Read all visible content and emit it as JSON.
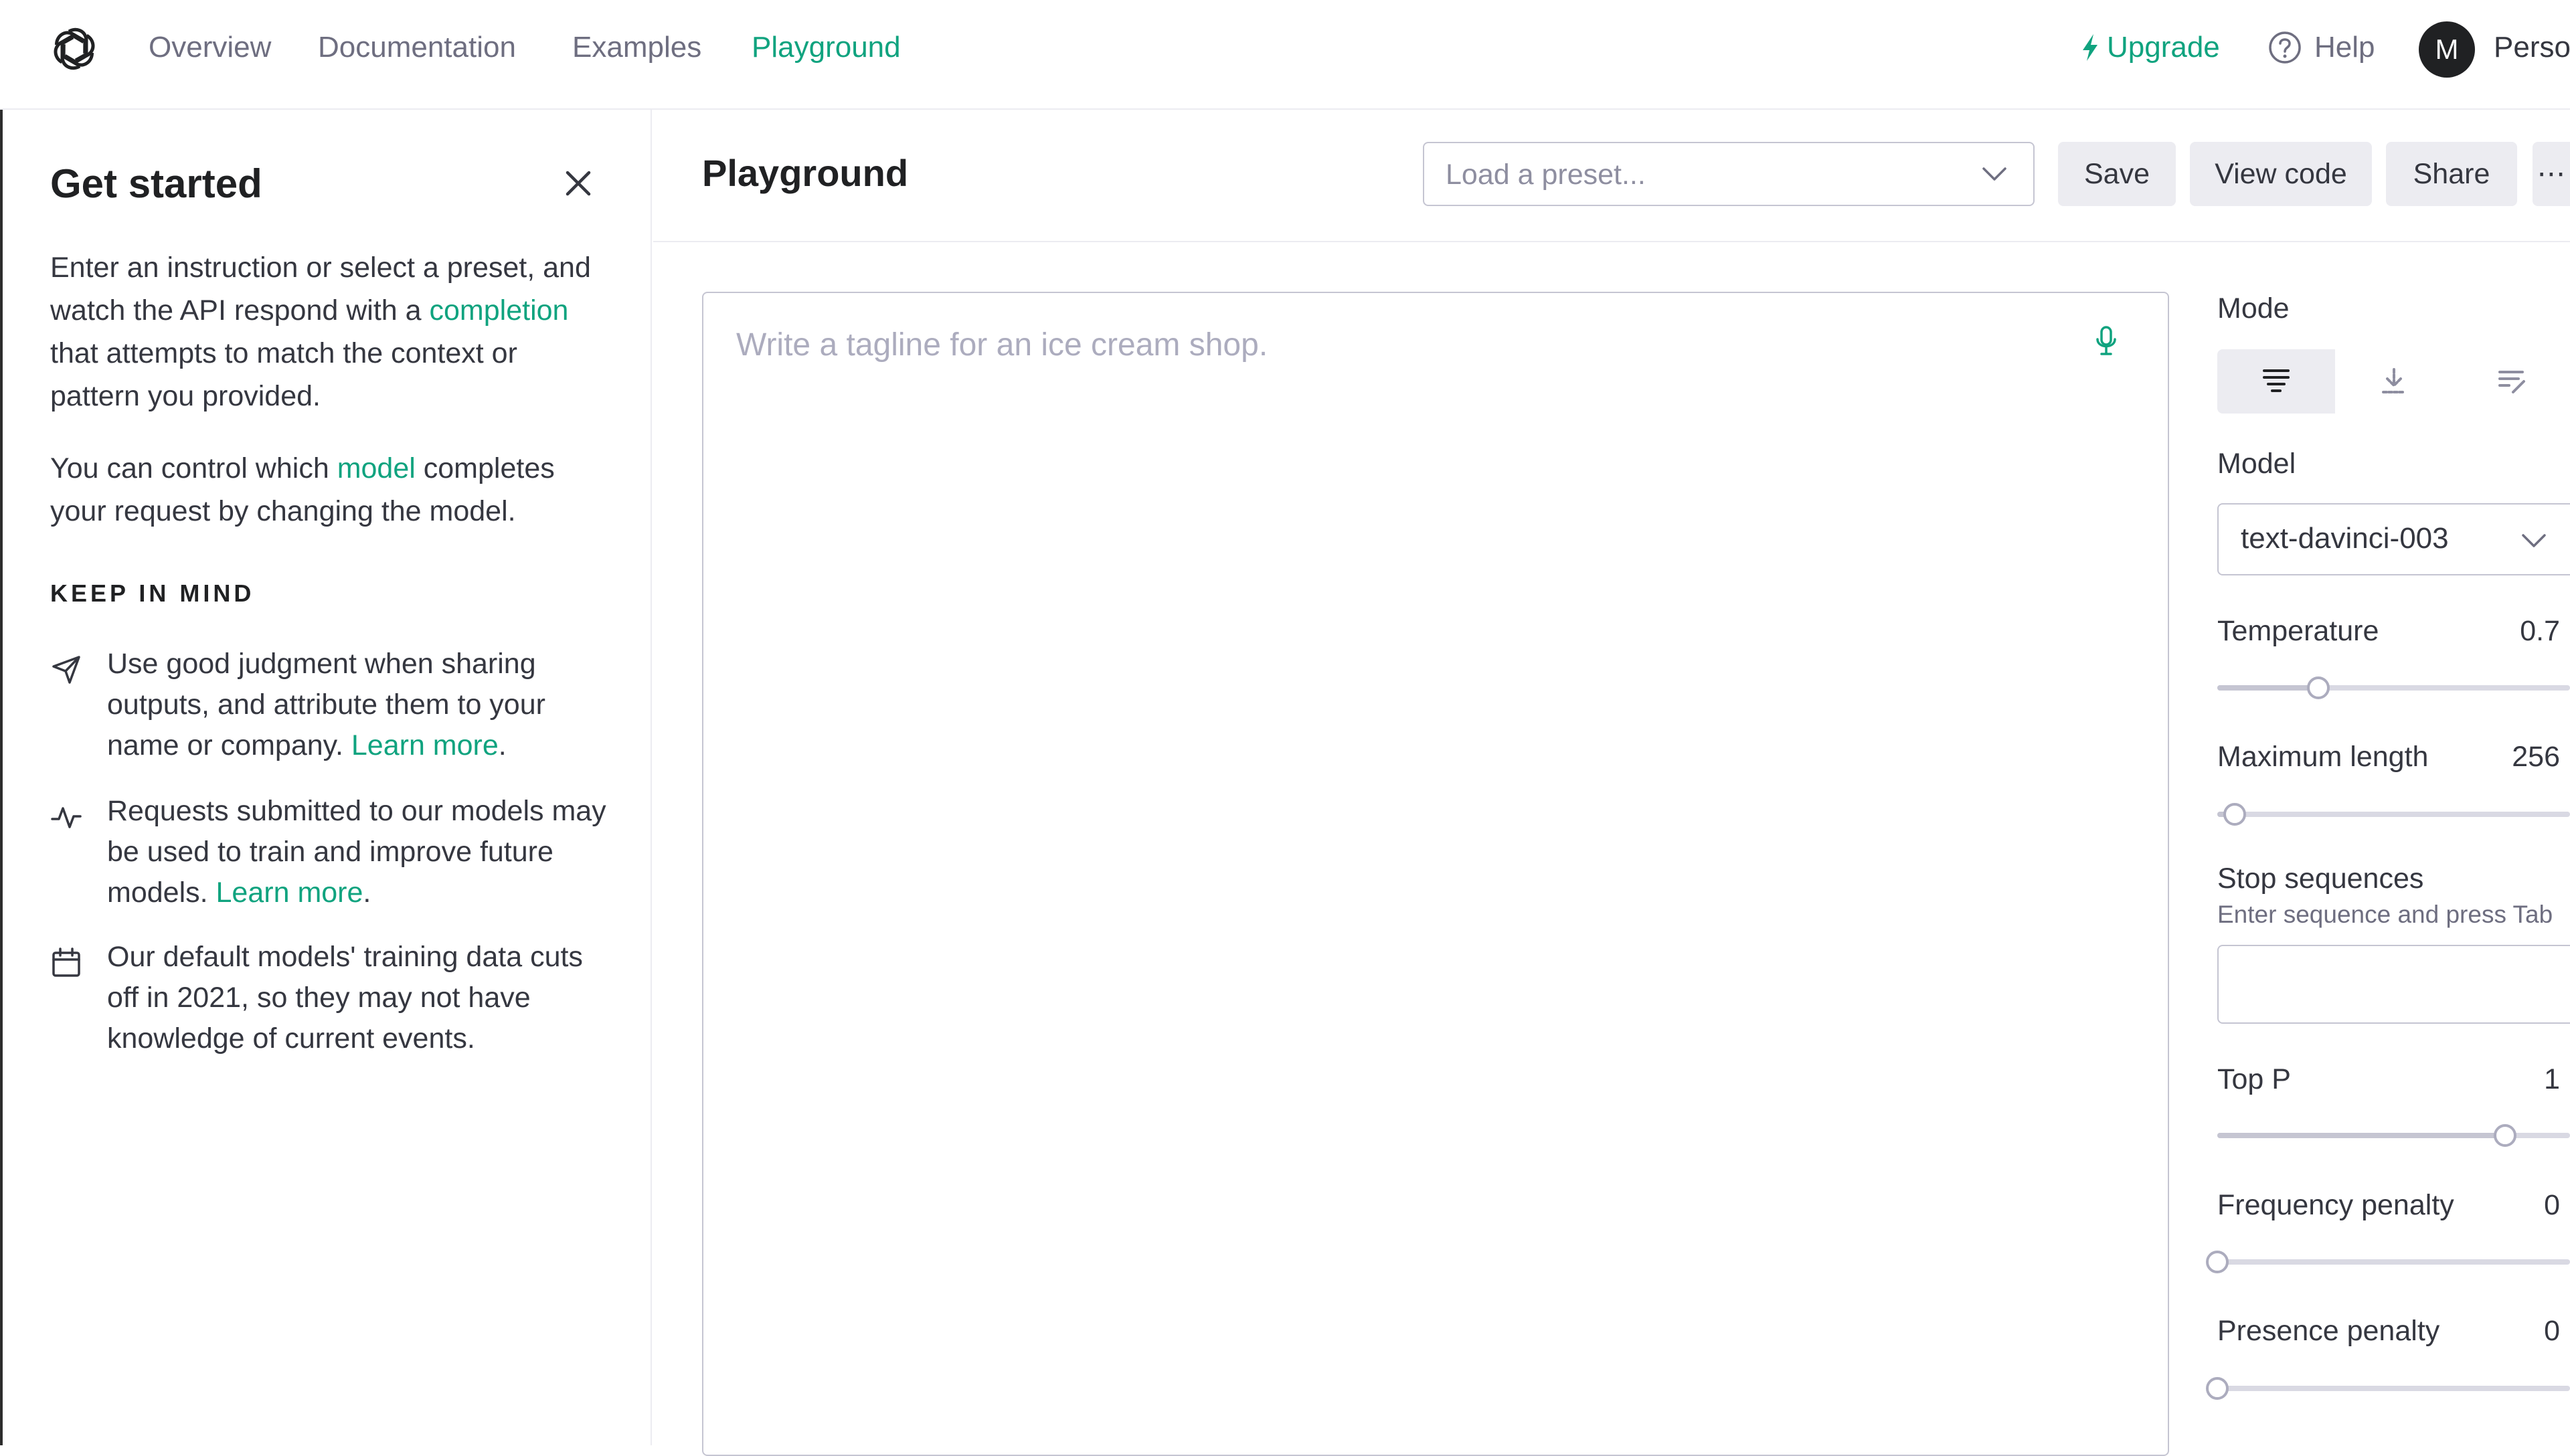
{
  "nav": {
    "links": [
      "Overview",
      "Documentation",
      "Examples",
      "Playground"
    ],
    "upgrade": "Upgrade",
    "help": "Help",
    "avatar_initial": "M",
    "org": "Perso"
  },
  "get_started": {
    "title": "Get started",
    "intro_1a": "Enter an instruction or select a preset, and watch the API respond with a ",
    "intro_1_link": "completion",
    "intro_1b": " that attempts to match the context or pattern you provided.",
    "intro_2a": "You can control which ",
    "intro_2_link": "model",
    "intro_2b": " completes your request by changing the model.",
    "keep_in_mind": "KEEP IN MIND",
    "tips": [
      {
        "icon": "send-icon",
        "text": "Use good judgment when sharing outputs, and attribute them to your name or company. ",
        "link": "Learn more",
        "suffix": "."
      },
      {
        "icon": "activity-icon",
        "text": "Requests submitted to our models may be used to train and improve future models. ",
        "link": "Learn more",
        "suffix": "."
      },
      {
        "icon": "calendar-icon",
        "text": "Our default models' training data cuts off in 2021, so they may not have knowledge of current events.",
        "link": "",
        "suffix": ""
      }
    ]
  },
  "playground": {
    "title": "Playground",
    "preset_placeholder": "Load a preset...",
    "buttons": {
      "save": "Save",
      "view_code": "View code",
      "share": "Share",
      "more": "⋯"
    },
    "editor_placeholder": "Write a tagline for an ice cream shop."
  },
  "settings": {
    "mode_label": "Mode",
    "mode_options": [
      {
        "icon": "complete-mode-icon",
        "active": true
      },
      {
        "icon": "insert-mode-icon",
        "active": false
      },
      {
        "icon": "edit-mode-icon",
        "active": false
      }
    ],
    "model_label": "Model",
    "model_value": "text-davinci-003",
    "temperature": {
      "label": "Temperature",
      "value": "0.7",
      "fraction": 0.35
    },
    "max_length": {
      "label": "Maximum length",
      "value": "256",
      "fraction": 0.06
    },
    "stop_sequences": {
      "label": "Stop sequences",
      "hint": "Enter sequence and press Tab"
    },
    "top_p": {
      "label": "Top P",
      "value": "1",
      "fraction": 1.0
    },
    "frequency_penalty": {
      "label": "Frequency penalty",
      "value": "0",
      "fraction": 0.0
    },
    "presence_penalty": {
      "label": "Presence penalty",
      "value": "0",
      "fraction": 0.0
    }
  },
  "colors": {
    "accent": "#10a37f",
    "text": "#353740",
    "muted": "#6e6e80",
    "border": "#c5c5d2",
    "button_bg": "#ececf1"
  }
}
